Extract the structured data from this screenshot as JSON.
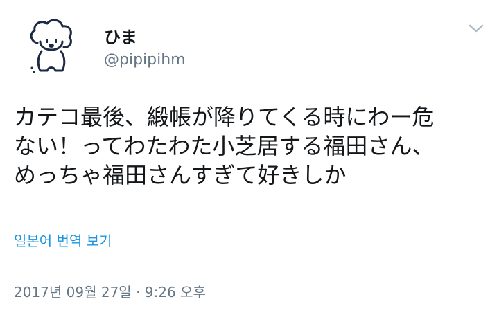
{
  "user": {
    "display_name": "ひま",
    "handle": "@pipipihm",
    "avatar_icon": "dog-illustration-avatar"
  },
  "tweet": {
    "lines": [
      "カテコ最後、緞帳が降りてくる時にわー危",
      "ない！ってわたわた小芝居する福田さん、",
      "めっちゃ福田さんすぎて好きしか"
    ],
    "translate_label": "일본어 번역 보기",
    "timestamp": "2017년 09월 27일 · 9:26 오후"
  },
  "menu": {
    "icon": "chevron-down-icon"
  },
  "colors": {
    "text": "#14171a",
    "secondary": "#657786",
    "link": "#1b95e0",
    "icon": "#1c2a44"
  }
}
